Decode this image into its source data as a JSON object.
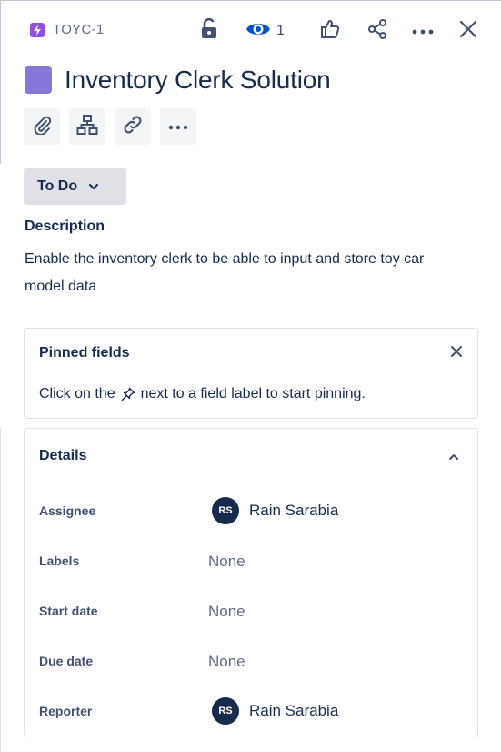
{
  "issue": {
    "key": "TOYC-1",
    "title": "Inventory Clerk Solution",
    "swatch_color": "#8777d9"
  },
  "header": {
    "watch_count": "1",
    "icons": [
      "lock-icon",
      "eye-icon",
      "thumbs-up-icon",
      "share-icon",
      "more-icon",
      "close-icon"
    ]
  },
  "toolbar": {
    "icons": [
      "attachment-icon",
      "child-issues-icon",
      "link-icon",
      "more-icon"
    ]
  },
  "status": {
    "label": "To Do"
  },
  "description": {
    "heading": "Description",
    "text": "Enable the inventory clerk to be able to input and store toy car model data"
  },
  "pinned": {
    "title": "Pinned fields",
    "message_before": "Click on the",
    "message_after": "next to a field label to start pinning."
  },
  "details": {
    "title": "Details",
    "fields": [
      {
        "label": "Assignee",
        "value": "Rain Sarabia",
        "initials": "RS"
      },
      {
        "label": "Labels",
        "value": "None"
      },
      {
        "label": "Start date",
        "value": "None"
      },
      {
        "label": "Due date",
        "value": "None"
      },
      {
        "label": "Reporter",
        "value": "Rain Sarabia",
        "initials": "RS"
      }
    ]
  },
  "colors": {
    "accent": "#904ee2",
    "watch_blue": "#0052cc",
    "text": "#172b4d"
  }
}
